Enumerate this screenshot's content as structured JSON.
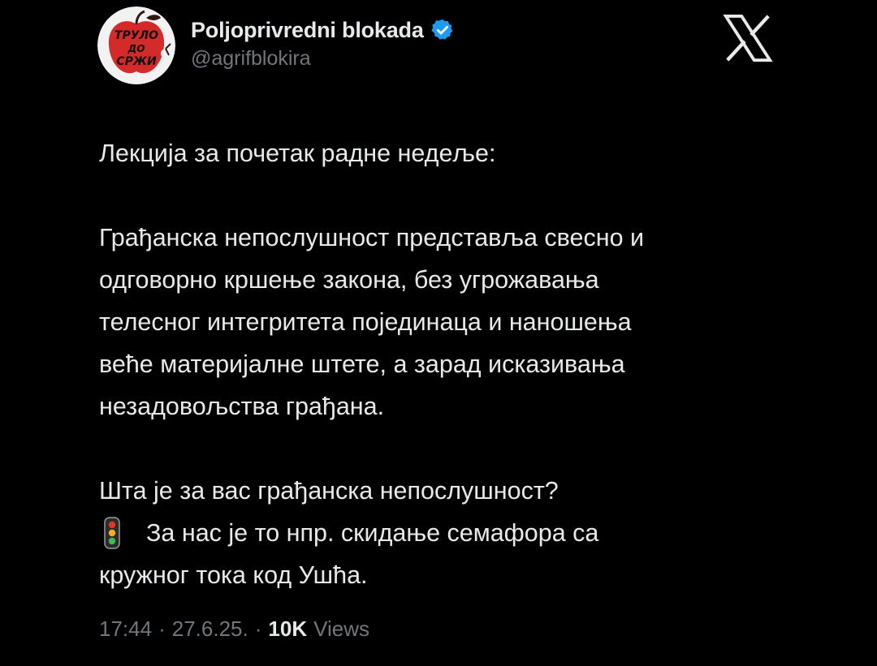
{
  "account": {
    "display_name": "Poljoprivredni blokada",
    "handle": "@agrifblokira",
    "verified": true,
    "avatar_icon": "avatar-apple-logo",
    "avatar_text": "ТРУЛО ДО СРЖИ"
  },
  "platform_icon": "x-logo-icon",
  "tweet": {
    "line1": "Лекција за почетак радне недеље:",
    "paragraph2": "Грађанска непослушност представља свесно и\nодговорно кршење закона, без угрожавања\nтелесног интегритета појединаца и наношења\nвеће материјалне штете, а зарад исказивања\nнезадовољства грађана.",
    "question": "Шта је за вас грађанска непослушност?",
    "emoji": "traffic-light-icon",
    "answer_line1": "За нас је то нпр. скидање семафора са",
    "answer_line2": "кружног тока код Ушћа."
  },
  "meta": {
    "time": "17:44",
    "date": "27.6.25.",
    "separator": "·",
    "views_count": "10K",
    "views_label": "Views"
  },
  "colors": {
    "background": "#000000",
    "text": "#e7e9ea",
    "secondary": "#71767b",
    "verified": "#1d9bf0",
    "avatar_red": "#d42a2a"
  }
}
